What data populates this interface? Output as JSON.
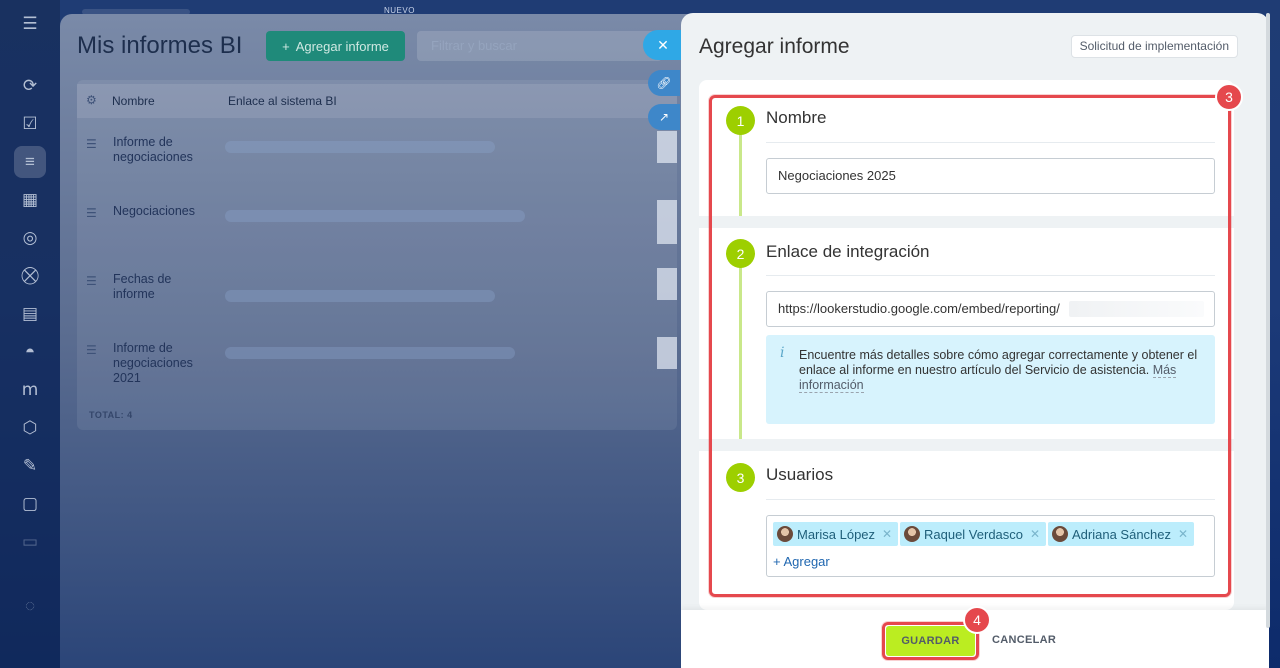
{
  "background": {
    "new_tag": "NUEVO",
    "title": "Mis informes BI",
    "add_button": "Agregar informe",
    "filter_placeholder": "Filtrar y buscar",
    "columns": [
      "Nombre",
      "Enlace al sistema BI"
    ],
    "rows": [
      {
        "name": "Informe de negociaciones"
      },
      {
        "name": "Negociaciones"
      },
      {
        "name": "Fechas de informe"
      },
      {
        "name": "Informe de negociaciones 2021"
      }
    ],
    "total": "TOTAL: 4"
  },
  "slider": {
    "title": "Agregar informe",
    "request_button": "Solicitud de implementación",
    "sections": {
      "name": {
        "step": "1",
        "title": "Nombre",
        "value": "Negociaciones 2025"
      },
      "link": {
        "step": "2",
        "title": "Enlace de integración",
        "value": "https://lookerstudio.google.com/embed/reporting/",
        "info_text": "Encuentre más detalles sobre cómo agregar correctamente y obtener el enlace al informe en nuestro artículo del Servicio de asistencia.",
        "info_link": "Más información"
      },
      "users": {
        "step": "3",
        "title": "Usuarios",
        "chips": [
          "Marisa López",
          "Raquel Verdasco",
          "Adriana Sánchez"
        ],
        "add_label": "+ Agregar"
      }
    },
    "callouts": {
      "form": "3",
      "save": "4"
    },
    "footer": {
      "save": "GUARDAR",
      "cancel": "CANCELAR"
    }
  },
  "colors": {
    "step_green": "#9dcf00",
    "save_button": "#bbed21",
    "highlight_red": "#e5484d",
    "info_background": "#d7f3fd",
    "chip_background": "#bcedfc"
  }
}
